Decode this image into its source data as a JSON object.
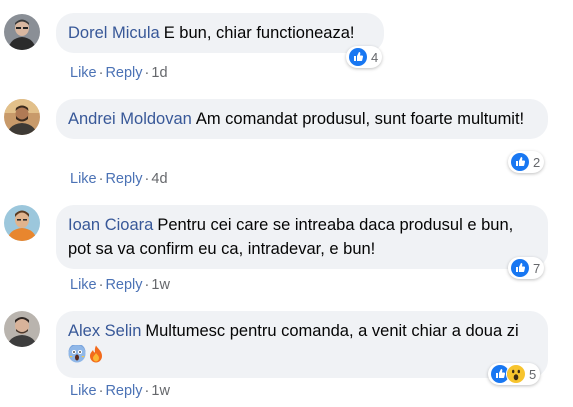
{
  "comments": [
    {
      "author": "Dorel Micula",
      "text": "E bun, chiar functioneaza!",
      "like_label": "Like",
      "reply_label": "Reply",
      "time": "1d",
      "reaction_count": "4",
      "reactions": [
        "like-icon"
      ],
      "avatar": "avatar-dorel"
    },
    {
      "author": "Andrei Moldovan",
      "text": "Am comandat produsul, sunt foarte multumit!",
      "like_label": "Like",
      "reply_label": "Reply",
      "time": "4d",
      "reaction_count": "2",
      "reactions": [
        "like-icon"
      ],
      "avatar": "avatar-andrei"
    },
    {
      "author": "Ioan Cioara",
      "text": "Pentru cei care se intreaba daca produsul e bun, pot sa va confirm eu ca, intradevar, e bun!",
      "like_label": "Like",
      "reply_label": "Reply",
      "time": "1w",
      "reaction_count": "7",
      "reactions": [
        "like-icon"
      ],
      "avatar": "avatar-ioan"
    },
    {
      "author": "Alex Selin",
      "text": "Multumesc pentru comanda, a venit chiar a doua zi",
      "emojis": [
        "screaming-face-emoji",
        "fire-emoji"
      ],
      "like_label": "Like",
      "reply_label": "Reply",
      "time": "1w",
      "reaction_count": "5",
      "reactions": [
        "like-icon",
        "wow-icon"
      ],
      "avatar": "avatar-alex"
    }
  ],
  "colors": {
    "author": "#385898",
    "action_link": "#4b72b5",
    "muted": "#65676b",
    "bubble": "#f0f2f5",
    "like_blue": "#1877f2"
  }
}
